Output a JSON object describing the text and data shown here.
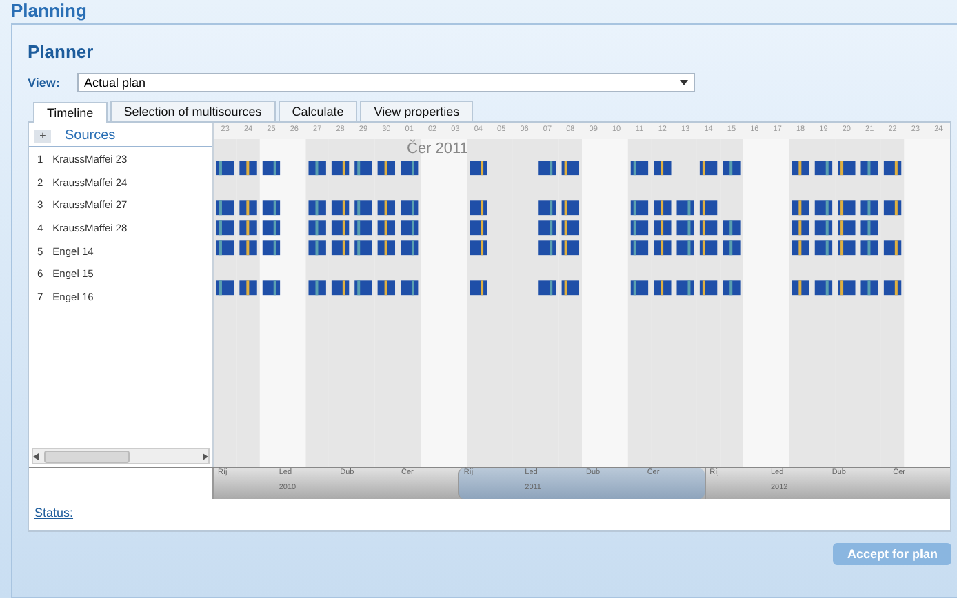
{
  "page_title": "Planning",
  "panel_title": "Planner",
  "view": {
    "label": "View:",
    "value": "Actual plan"
  },
  "tabs": [
    {
      "label": "Timeline",
      "selected": true
    },
    {
      "label": "Selection of multisources",
      "selected": false
    },
    {
      "label": "Calculate",
      "selected": false
    },
    {
      "label": "View properties",
      "selected": false
    }
  ],
  "sources": {
    "collapse": "+",
    "header": "Sources",
    "items": [
      {
        "number": "1",
        "name": "KraussMaffei 23"
      },
      {
        "number": "2",
        "name": "KraussMaffei 24"
      },
      {
        "number": "3",
        "name": "KraussMaffei 27"
      },
      {
        "number": "4",
        "name": "KraussMaffei 28"
      },
      {
        "number": "5",
        "name": "Engel 14"
      },
      {
        "number": "6",
        "name": "Engel 15"
      },
      {
        "number": "7",
        "name": "Engel 16"
      }
    ]
  },
  "timeline": {
    "days": [
      "23",
      "24",
      "25",
      "26",
      "27",
      "28",
      "29",
      "30",
      "01",
      "02",
      "03",
      "04",
      "05",
      "06",
      "07",
      "08",
      "09",
      "10",
      "11",
      "12",
      "13",
      "14",
      "15",
      "16",
      "17",
      "18",
      "19",
      "20",
      "21",
      "22",
      "23",
      "24"
    ],
    "month_marker": "Čer 2011",
    "navigator": [
      {
        "months": [
          "Říj",
          "Led",
          "Dub",
          "Čer"
        ],
        "year": "2010",
        "selected": false
      },
      {
        "months": [
          "Říj",
          "Led",
          "Dub",
          "Čer"
        ],
        "year": "2011",
        "selected": true
      },
      {
        "months": [
          "Říj",
          "Led",
          "Dub",
          "Čer"
        ],
        "year": "2012",
        "selected": false
      }
    ]
  },
  "status": "Status:",
  "accept_button": {
    "label": "Accept for plan",
    "disabled": true
  }
}
